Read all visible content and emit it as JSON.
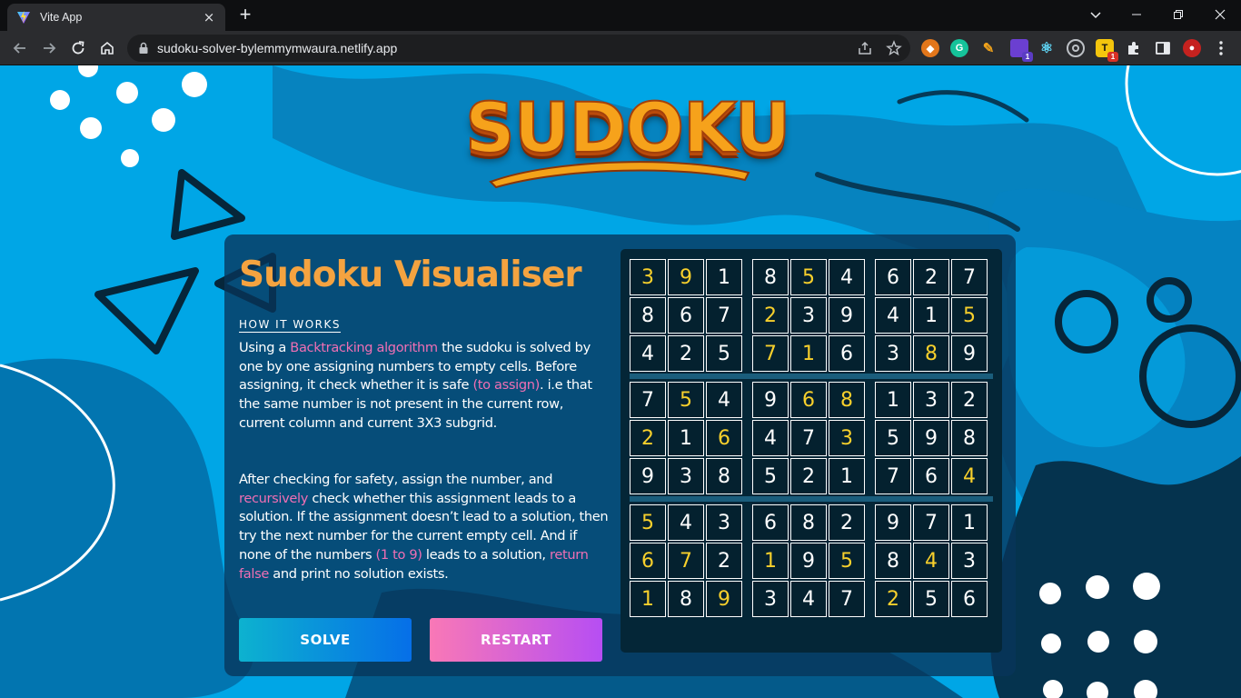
{
  "browser": {
    "tab_title": "Vite App",
    "tab_close": "×",
    "new_tab": "+",
    "url": "sudoku-solver-bylemmymwaura.netlify.app",
    "extension_badges": [
      "1",
      "1"
    ]
  },
  "logo": {
    "text": "SUDOKU"
  },
  "panel": {
    "title": "Sudoku Visualiser",
    "section_heading": "HOW IT WORKS",
    "paragraph1": [
      {
        "text": "Using a ",
        "highlight": false
      },
      {
        "text": "Backtracking algorithm",
        "highlight": true
      },
      {
        "text": " the sudoku is solved by one by one assigning numbers to empty cells. Before assigning, it check whether it is safe ",
        "highlight": false
      },
      {
        "text": "(to assign)",
        "highlight": true
      },
      {
        "text": ". i.e that the same number is not present in the current row, current column and current 3X3 subgrid.",
        "highlight": false
      }
    ],
    "paragraph2": [
      {
        "text": "After checking for safety, assign the number, and ",
        "highlight": false
      },
      {
        "text": "recursively",
        "highlight": true
      },
      {
        "text": " check whether this assignment leads to a solution. If the assignment doesn’t lead to a solution, then try the next number for the current empty cell. And if none of the numbers ",
        "highlight": false
      },
      {
        "text": "(1 to 9)",
        "highlight": true
      },
      {
        "text": " leads to a solution, ",
        "highlight": false
      },
      {
        "text": "return false",
        "highlight": true
      },
      {
        "text": " and print no solution exists.",
        "highlight": false
      }
    ],
    "solve_label": "SOLVE",
    "restart_label": "RESTART"
  },
  "colors": {
    "highlight": "#f06fb4",
    "given_digit": "#f8d02c",
    "solved_digit": "#ffffff",
    "title": "#f4a340"
  },
  "board": {
    "rows": [
      [
        3,
        9,
        1,
        8,
        5,
        4,
        6,
        2,
        7
      ],
      [
        8,
        6,
        7,
        2,
        3,
        9,
        4,
        1,
        5
      ],
      [
        4,
        2,
        5,
        7,
        1,
        6,
        3,
        8,
        9
      ],
      [
        7,
        5,
        4,
        9,
        6,
        8,
        1,
        3,
        2
      ],
      [
        2,
        1,
        6,
        4,
        7,
        3,
        5,
        9,
        8
      ],
      [
        9,
        3,
        8,
        5,
        2,
        1,
        7,
        6,
        4
      ],
      [
        5,
        4,
        3,
        6,
        8,
        2,
        9,
        7,
        1
      ],
      [
        6,
        7,
        2,
        1,
        9,
        5,
        8,
        4,
        3
      ],
      [
        1,
        8,
        9,
        3,
        4,
        7,
        2,
        5,
        6
      ]
    ],
    "given": [
      [
        1,
        1,
        0,
        0,
        1,
        0,
        0,
        0,
        0
      ],
      [
        0,
        0,
        0,
        1,
        0,
        0,
        0,
        0,
        1
      ],
      [
        0,
        0,
        0,
        1,
        1,
        0,
        0,
        1,
        0
      ],
      [
        0,
        1,
        0,
        0,
        1,
        1,
        0,
        0,
        0
      ],
      [
        1,
        0,
        1,
        0,
        0,
        1,
        0,
        0,
        0
      ],
      [
        0,
        0,
        0,
        0,
        0,
        0,
        0,
        0,
        1
      ],
      [
        1,
        0,
        0,
        0,
        0,
        0,
        0,
        0,
        0
      ],
      [
        1,
        1,
        0,
        1,
        0,
        1,
        0,
        1,
        0
      ],
      [
        1,
        0,
        1,
        0,
        0,
        0,
        1,
        0,
        0
      ]
    ]
  }
}
